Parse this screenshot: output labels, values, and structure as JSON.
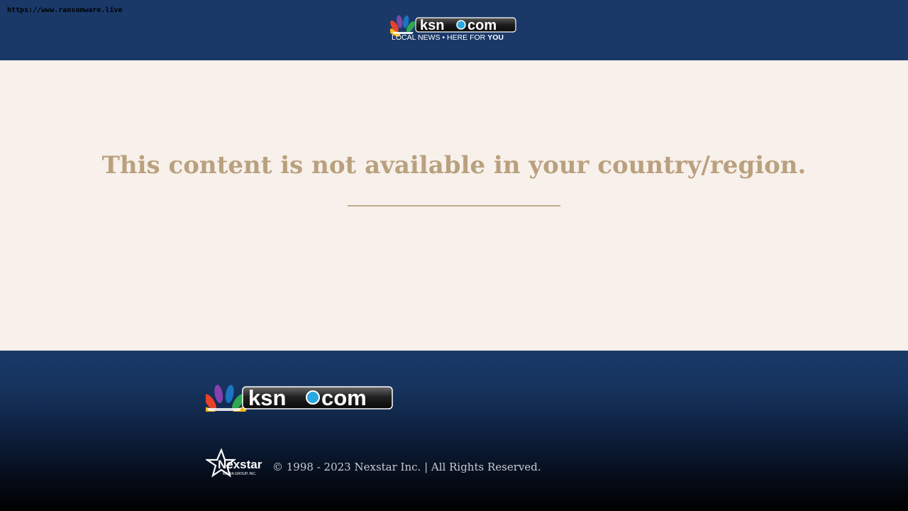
{
  "watermark": {
    "url": "https://www.ransomware.live"
  },
  "header": {
    "logo": {
      "icon": "nbc-peacock-icon",
      "wordmark_ksn": "ksn",
      "wordmark_com": "com",
      "tagline_prefix": "LOCAL NEWS",
      "tagline_separator": "•",
      "tagline_middle": "HERE FOR",
      "tagline_emphasis": "YOU"
    }
  },
  "main": {
    "message": "This content is not available in your country/region."
  },
  "footer": {
    "logo": {
      "icon": "nbc-peacock-icon",
      "wordmark_ksn": "ksn",
      "wordmark_com": "com"
    },
    "nexstar_logo": {
      "icon": "nexstar-star-icon",
      "name": "Nexstar",
      "subtitle": "MEDIA GROUP, INC."
    },
    "copyright": "© 1998 - 2023 Nexstar Inc. | All Rights Reserved."
  },
  "colors": {
    "header_bg": "#1a3968",
    "main_bg": "#f8f0ea",
    "message_text": "#b9a17f",
    "divider": "#c3aa8f",
    "footer_text": "#c8ccd3"
  }
}
